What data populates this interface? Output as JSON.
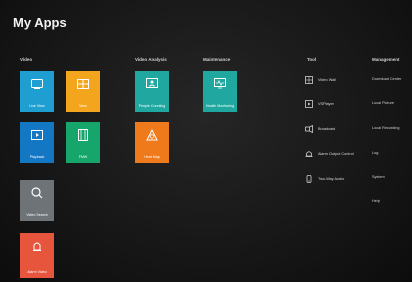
{
  "title": "My Apps",
  "sections": {
    "video": "Video",
    "video_analysis": "Video Analysis",
    "maintenance": "Maintenance",
    "tool": "Tool",
    "management": "Management"
  },
  "tiles": {
    "live_view": {
      "label": "Live View",
      "icon": "monitor-icon",
      "color": "#1f9fd1"
    },
    "view": {
      "label": "View",
      "icon": "grid-view-icon",
      "color": "#f2a51d"
    },
    "playback": {
      "label": "Playback",
      "icon": "play-icon",
      "color": "#1377c4"
    },
    "fmw": {
      "label": "FMW",
      "icon": "film-icon",
      "color": "#16a56a"
    },
    "video_search": {
      "label": "Video Search",
      "icon": "search-icon",
      "color": "#6e7378"
    },
    "alarm_video": {
      "label": "Alarm Video",
      "icon": "alarm-icon",
      "color": "#e7553c"
    },
    "people_counting": {
      "label": "People Counting",
      "icon": "people-counting-icon",
      "color": "#1fa7a0"
    },
    "heat_map": {
      "label": "Heat Map",
      "icon": "heat-map-icon",
      "color": "#ee7a1c"
    },
    "health_monitoring": {
      "label": "Health Monitoring",
      "icon": "health-monitor-icon",
      "color": "#1fa7a0"
    }
  },
  "tools": [
    {
      "label": "Video Wall",
      "icon": "video-wall-icon"
    },
    {
      "label": "VSPlayer",
      "icon": "player-icon"
    },
    {
      "label": "Broadcast",
      "icon": "broadcast-icon"
    },
    {
      "label": "Alarm Output Control",
      "icon": "alarm-output-icon"
    },
    {
      "label": "Two-Way Audio",
      "icon": "two-way-audio-icon"
    }
  ],
  "management": [
    {
      "label": "Download Center"
    },
    {
      "label": "Local Picture"
    },
    {
      "label": "Local Recording"
    },
    {
      "label": "Log"
    },
    {
      "label": "System"
    },
    {
      "label": "Help"
    }
  ]
}
